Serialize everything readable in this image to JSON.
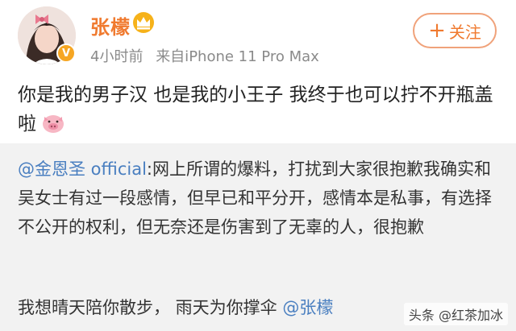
{
  "user": {
    "name": "张檬",
    "time": "4小时前",
    "source": "来自iPhone 11 Pro Max",
    "vip_badge": "V"
  },
  "follow_button": {
    "plus": "+",
    "label": "关注"
  },
  "post": {
    "text": "你是我的男子汉  也是我的小王子  我终于也可以拧不开瓶盖啦"
  },
  "repost": {
    "mention": "@金恩圣 official",
    "text": ":网上所谓的爆料，打扰到大家很抱歉我确实和吴女士有过一段感情，但早已和平分开，感情本是私事，有选择不公开的权利，但无奈还是伤害到了无辜的人，很抱歉",
    "reply_text": "我想晴天陪你散步，  雨天为你撑伞 ",
    "reply_mention": "@张檬"
  },
  "watermark": "头条 @红茶加冰",
  "colors": {
    "accent": "#f07a2f",
    "mention": "#4a7fc0",
    "repost_bg": "#f2f2f2"
  }
}
